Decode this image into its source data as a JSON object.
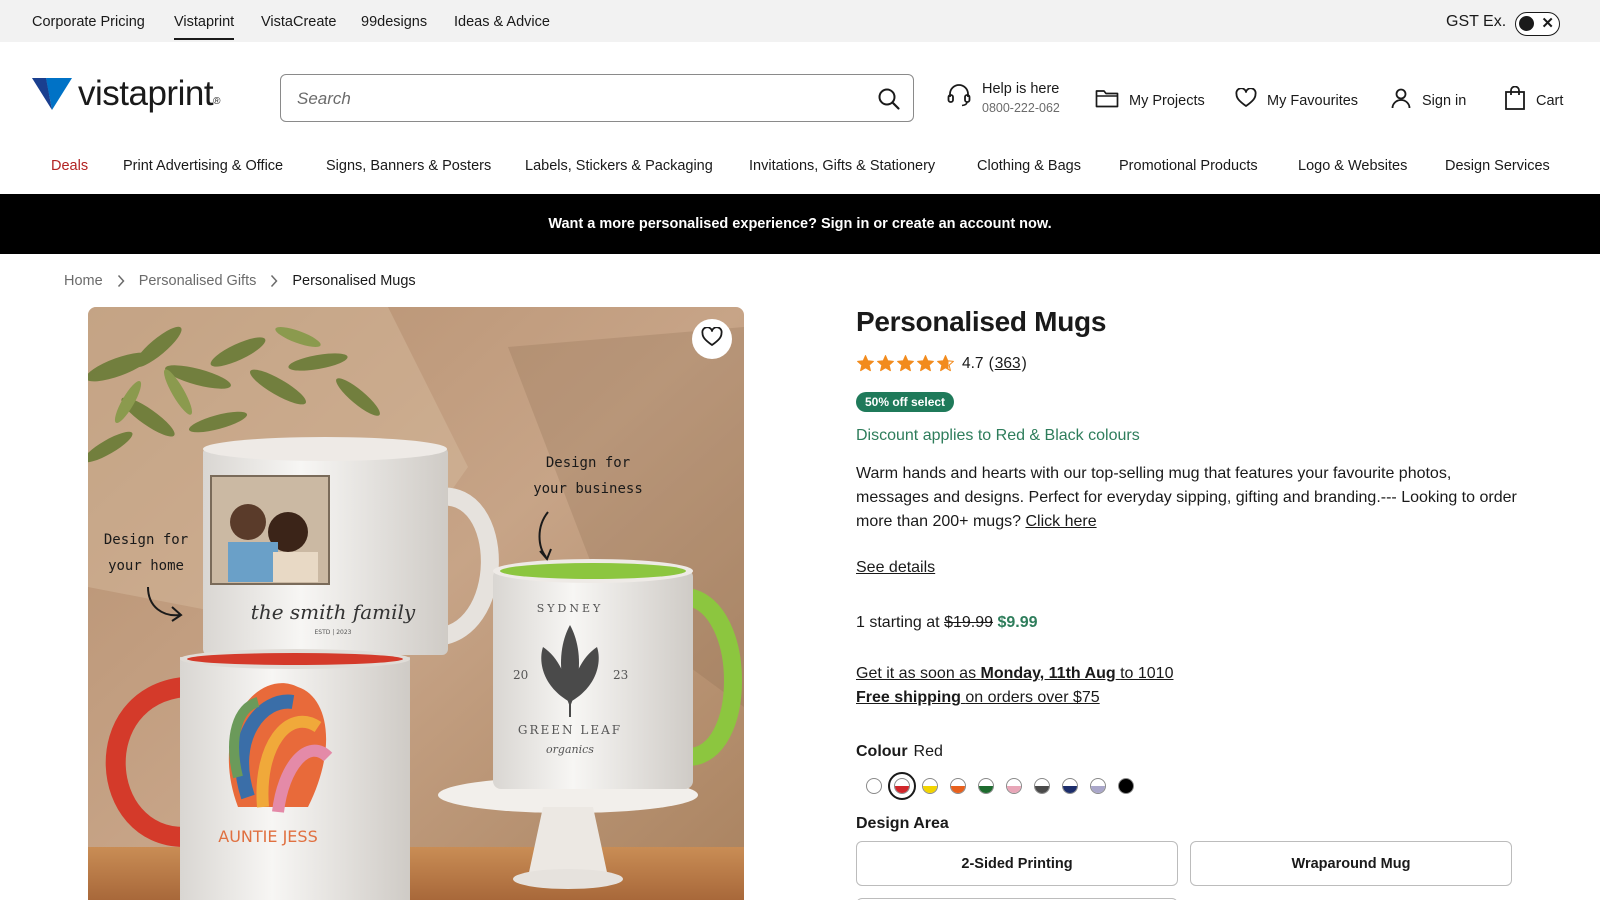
{
  "utility_bar": {
    "links": [
      "Corporate Pricing",
      "Vistaprint",
      "VistaCreate",
      "99designs",
      "Ideas & Advice"
    ],
    "active_link": "Vistaprint",
    "tax_toggle_label": "GST Ex.",
    "tax_toggle_state": "off"
  },
  "header": {
    "logo_text": "vistaprint",
    "logo_mark": "®",
    "search": {
      "placeholder": "Search",
      "value": ""
    },
    "help": {
      "label": "Help is here",
      "phone": "0800-222-062"
    },
    "my_projects": "My Projects",
    "my_favourites": "My Favourites",
    "sign_in": "Sign in",
    "cart": "Cart"
  },
  "category_nav": [
    "Deals",
    "Print Advertising & Office",
    "Signs, Banners & Posters",
    "Labels, Stickers & Packaging",
    "Invitations, Gifts & Stationery",
    "Clothing & Bags",
    "Promotional Products",
    "Logo & Websites",
    "Design Services"
  ],
  "promo_banner": "Want a more personalised experience? Sign in or create an account now.",
  "breadcrumb": [
    "Home",
    "Personalised Gifts",
    "Personalised Mugs"
  ],
  "product_image": {
    "callout_home": [
      "Design for",
      "your home"
    ],
    "callout_business": [
      "Design for",
      "your business"
    ],
    "mug_family_text": "the smith family",
    "mug_family_sub": "ESTD | 2023",
    "mug_auntie_text": "AUNTIE JESS",
    "mug_green_top": "SYDNEY",
    "mug_green_left": "20",
    "mug_green_right": "23",
    "mug_green_name": "GREEN LEAF",
    "mug_green_sub": "organics"
  },
  "product": {
    "title": "Personalised Mugs",
    "rating": "4.7",
    "rating_value": 4.7,
    "review_count": "363",
    "badge": "50% off select",
    "discount_note": "Discount applies to Red & Black colours",
    "description": "Warm hands and hearts with our top-selling mug that features your favourite photos, messages and designs. Perfect for everyday sipping, gifting and branding.--- Looking to order more than 200+ mugs?",
    "description_link": "Click here",
    "see_details": "See details",
    "price_prefix": "1 starting at",
    "price_old": "$19.99",
    "price_new": "$9.99",
    "delivery_prefix": "Get it as soon as",
    "delivery_date": "Monday, 11th Aug",
    "delivery_suffix": "to 1010",
    "free_shipping": "Free shipping",
    "free_shipping_suffix": "on orders over $75",
    "colour_label": "Colour",
    "colour_selected": "Red",
    "colours": [
      {
        "name": "white",
        "hex": "#ffffff"
      },
      {
        "name": "red",
        "hex": "#d0262b"
      },
      {
        "name": "yellow",
        "hex": "#f2d400"
      },
      {
        "name": "orange",
        "hex": "#e8601c"
      },
      {
        "name": "green",
        "hex": "#1d6b2e"
      },
      {
        "name": "pink",
        "hex": "#e8a6b8"
      },
      {
        "name": "grey",
        "hex": "#4a4a4a"
      },
      {
        "name": "navy",
        "hex": "#1c2d6b"
      },
      {
        "name": "lavender",
        "hex": "#a9a6c9"
      },
      {
        "name": "black",
        "hex": "#000000"
      }
    ],
    "design_area_label": "Design Area",
    "design_options": [
      "2-Sided Printing",
      "Wraparound Mug"
    ]
  },
  "colors": {
    "brand_blue": "#0072c6",
    "sale_green": "#1f7a5a",
    "deal_red": "#b22222",
    "star_orange": "#f28b1d"
  }
}
